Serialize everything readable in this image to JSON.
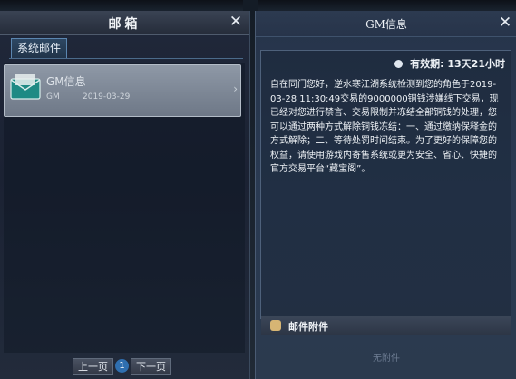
{
  "mailbox": {
    "title": "邮箱",
    "close_symbol": "✕",
    "tab_system_mail": "系统邮件",
    "items": [
      {
        "sender": "GM信息",
        "from": "GM",
        "date": "2019-03-29"
      }
    ],
    "pager": {
      "prev_label": "上一页",
      "page": "1",
      "next_label": "下一页"
    }
  },
  "gm_message": {
    "title": "GM信息",
    "close_symbol": "✕",
    "validity_label": "有效期:",
    "validity_value": "13天21小时",
    "body": "自在同门您好，逆水寒江湖系统检测到您的角色于2019-03-28 11:30:49交易的9000000铜钱涉嫌线下交易，现已经对您进行禁言、交易限制并冻结全部铜钱的处理，您可以通过两种方式解除铜钱冻结：一、通过缴纳保释金的方式解除；二、等待处罚时间结束。为了更好的保障您的权益，请使用游戏内寄售系统或更为安全、省心、快捷的官方交易平台“藏宝阁”。",
    "attachments_label": "邮件附件",
    "no_attachments": "无附件"
  },
  "icons": [
    "envelope-icon",
    "clock-icon",
    "bag-icon",
    "close-icon",
    "chevron-right-icon"
  ]
}
